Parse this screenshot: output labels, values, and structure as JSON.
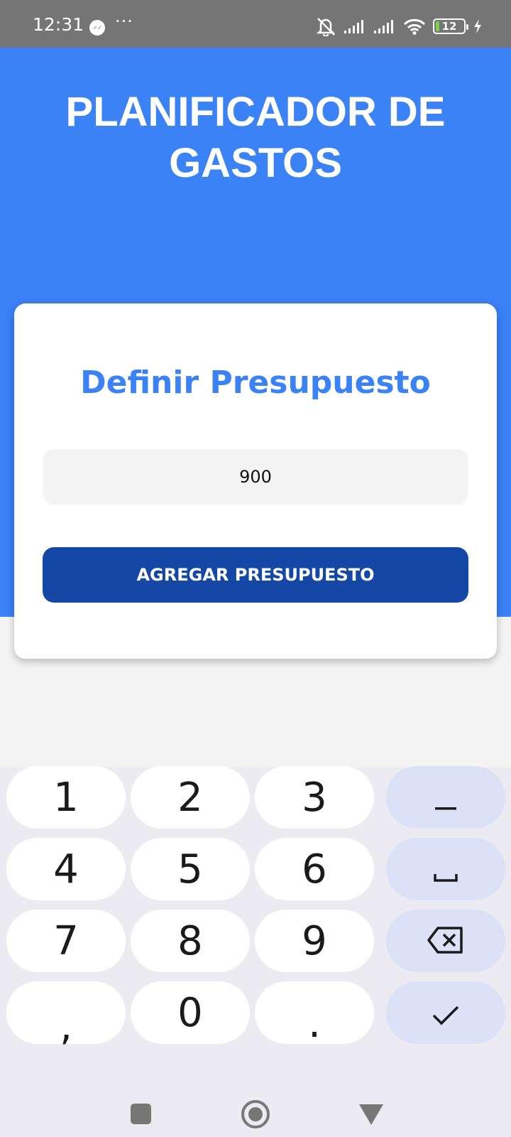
{
  "status_bar": {
    "time": "12:31",
    "more": "···",
    "battery_level": "12",
    "battery_fraction": 0.12,
    "icons": [
      "messenger-icon",
      "mute-icon",
      "signal-icon",
      "signal-icon",
      "wifi-icon",
      "battery-icon",
      "charging-icon"
    ]
  },
  "header": {
    "title": "PLANIFICADOR DE GASTOS"
  },
  "card": {
    "title": "Definir Presupuesto",
    "input_value": "900",
    "button_label": "AGREGAR PRESUPUESTO"
  },
  "keyboard": {
    "keys": [
      {
        "label": "1"
      },
      {
        "label": "2"
      },
      {
        "label": "3"
      },
      {
        "label": "–",
        "icon": "minus-icon"
      },
      {
        "label": "4"
      },
      {
        "label": "5"
      },
      {
        "label": "6"
      },
      {
        "label": "",
        "icon": "space-icon"
      },
      {
        "label": "7"
      },
      {
        "label": "8"
      },
      {
        "label": "9"
      },
      {
        "label": "",
        "icon": "backspace-icon"
      },
      {
        "label": ","
      },
      {
        "label": "0"
      },
      {
        "label": "."
      },
      {
        "label": "",
        "icon": "check-icon"
      }
    ]
  },
  "nav_bar": {
    "icons": [
      "recent-apps-icon",
      "home-icon",
      "back-icon"
    ]
  },
  "colors": {
    "status_bar": "#757575",
    "header": "#3b82f6",
    "card_title": "#3b82f6",
    "primary_button": "#1547a6",
    "input_bg": "#f4f4f5",
    "keyboard_bg": "#ecebf1",
    "key_bg": "#ffffff",
    "function_key_bg": "#dbe1f6",
    "battery_fill": "#7cd34a"
  }
}
